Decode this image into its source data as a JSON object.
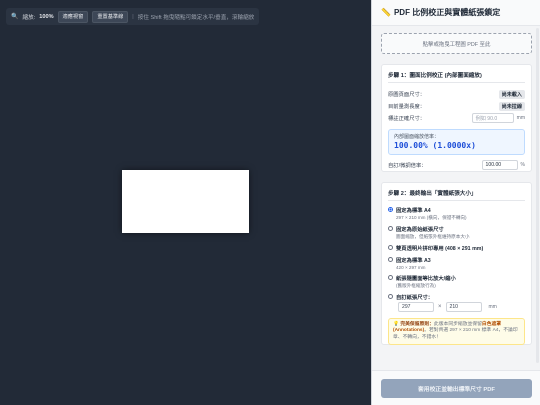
{
  "toolbar": {
    "zoom_label": "縮放:",
    "zoom_value": "100%",
    "fit_button": "適應視窗",
    "reset_button": "重置基準線",
    "separator": "|",
    "hint": "按住 Shift 拖曳隨點可鎖定水平/垂直，滾輪縮放"
  },
  "panel": {
    "title": "PDF 比例校正與實體紙張鎖定",
    "drop_zone": "點擊或拖曳工程圖 PDF 至此",
    "step1": {
      "title": "步驟 1：圖面比例校正 (內部圖面縮放)",
      "orig_size_label": "原圖頁面尺寸：",
      "orig_size_value": "尚未載入",
      "measured_label": "目前量測長度：",
      "measured_value": "尚未拉線",
      "target_label": "標註正確尺寸：",
      "target_placeholder": "例如 90.0",
      "target_unit": "mm",
      "ratio_label": "內部圖面縮放倍率：",
      "ratio_value": "100.00% (1.0000x)",
      "custom_ratio_label": "自訂/微調倍率：",
      "custom_ratio_value": "100.00",
      "custom_ratio_unit": "%"
    },
    "step2": {
      "title": "步驟 2：最終輸出「實體紙張大小」",
      "options": [
        {
          "title": "固定為標準 A4",
          "sub": "297 × 210 mm (橫向，保證不轉向)",
          "selected": true
        },
        {
          "title": "固定為原始紙張尺寸",
          "sub": "圖面縮放，但紙張外框維持原本大小",
          "selected": false
        },
        {
          "title": "雙頁透明片拼印專用 (408 × 291 mm)",
          "sub": "",
          "selected": false
        },
        {
          "title": "固定為標準 A3",
          "sub": "420 × 297 mm",
          "selected": false
        },
        {
          "title": "紙張隨圖面等比放大/縮小",
          "sub": "(舊版外框縮放行為)",
          "selected": false
        },
        {
          "title": "自訂紙張尺寸：",
          "sub": "",
          "selected": false
        }
      ],
      "custom_w": "297",
      "custom_h": "210",
      "custom_x": "×",
      "custom_unit": "mm",
      "note_icon": "💡",
      "note_bold1": "完美保留原則：",
      "note_text1": "此版本同步縮放並保留",
      "note_bold2": "白色遮罩 (Annotations)",
      "note_text2": "。若對齊選 297 × 210 mm 標準 A4，不論印章、不轉向，不錯水！"
    },
    "submit_button": "套用校正並輸出標準尺寸 PDF"
  },
  "colors": {
    "canvas_bg": "#222a37",
    "accent": "#2563eb",
    "submit_disabled": "#93a4bb"
  }
}
